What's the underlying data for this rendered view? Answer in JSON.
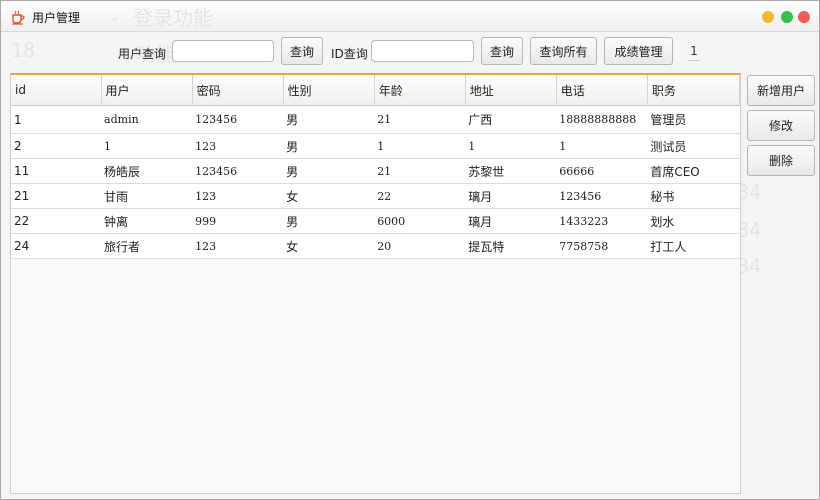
{
  "window": {
    "title": "用户管理"
  },
  "toolbar": {
    "user_query_label": "用户查询",
    "user_query_value": "",
    "query_button_1": "查询",
    "id_query_label": "ID查询",
    "id_query_value": "",
    "query_button_2": "查询",
    "query_all_button": "查询所有",
    "grades_button": "成绩管理",
    "page_number": "1"
  },
  "table": {
    "columns": [
      "id",
      "用户",
      "密码",
      "性别",
      "年龄",
      "地址",
      "电话",
      "职务"
    ],
    "rows": [
      [
        "1",
        "admin",
        "123456",
        "男",
        "21",
        "广西",
        "18888888888",
        "管理员"
      ],
      [
        "2",
        "1",
        "123",
        "男",
        "1",
        "1",
        "1",
        "测试员"
      ],
      [
        "11",
        "杨皓辰",
        "123456",
        "男",
        "21",
        "苏黎世",
        "66666",
        "首席CEO"
      ],
      [
        "21",
        "甘雨",
        "123",
        "女",
        "22",
        "璃月",
        "123456",
        "秘书"
      ],
      [
        "22",
        "钟离",
        "999",
        "男",
        "6000",
        "璃月",
        "1433223",
        "划水"
      ],
      [
        "24",
        "旅行者",
        "123",
        "女",
        "20",
        "提瓦特",
        "7758758",
        "打工人"
      ]
    ]
  },
  "side_actions": {
    "add_user": "新增用户",
    "edit": "修改",
    "delete": "删除"
  },
  "colors": {
    "accent": "#f0a040",
    "min": "#f6b72b",
    "max": "#35c24a",
    "close": "#f25a5a"
  },
  "icons": {
    "app": "coffee-cup-icon"
  }
}
